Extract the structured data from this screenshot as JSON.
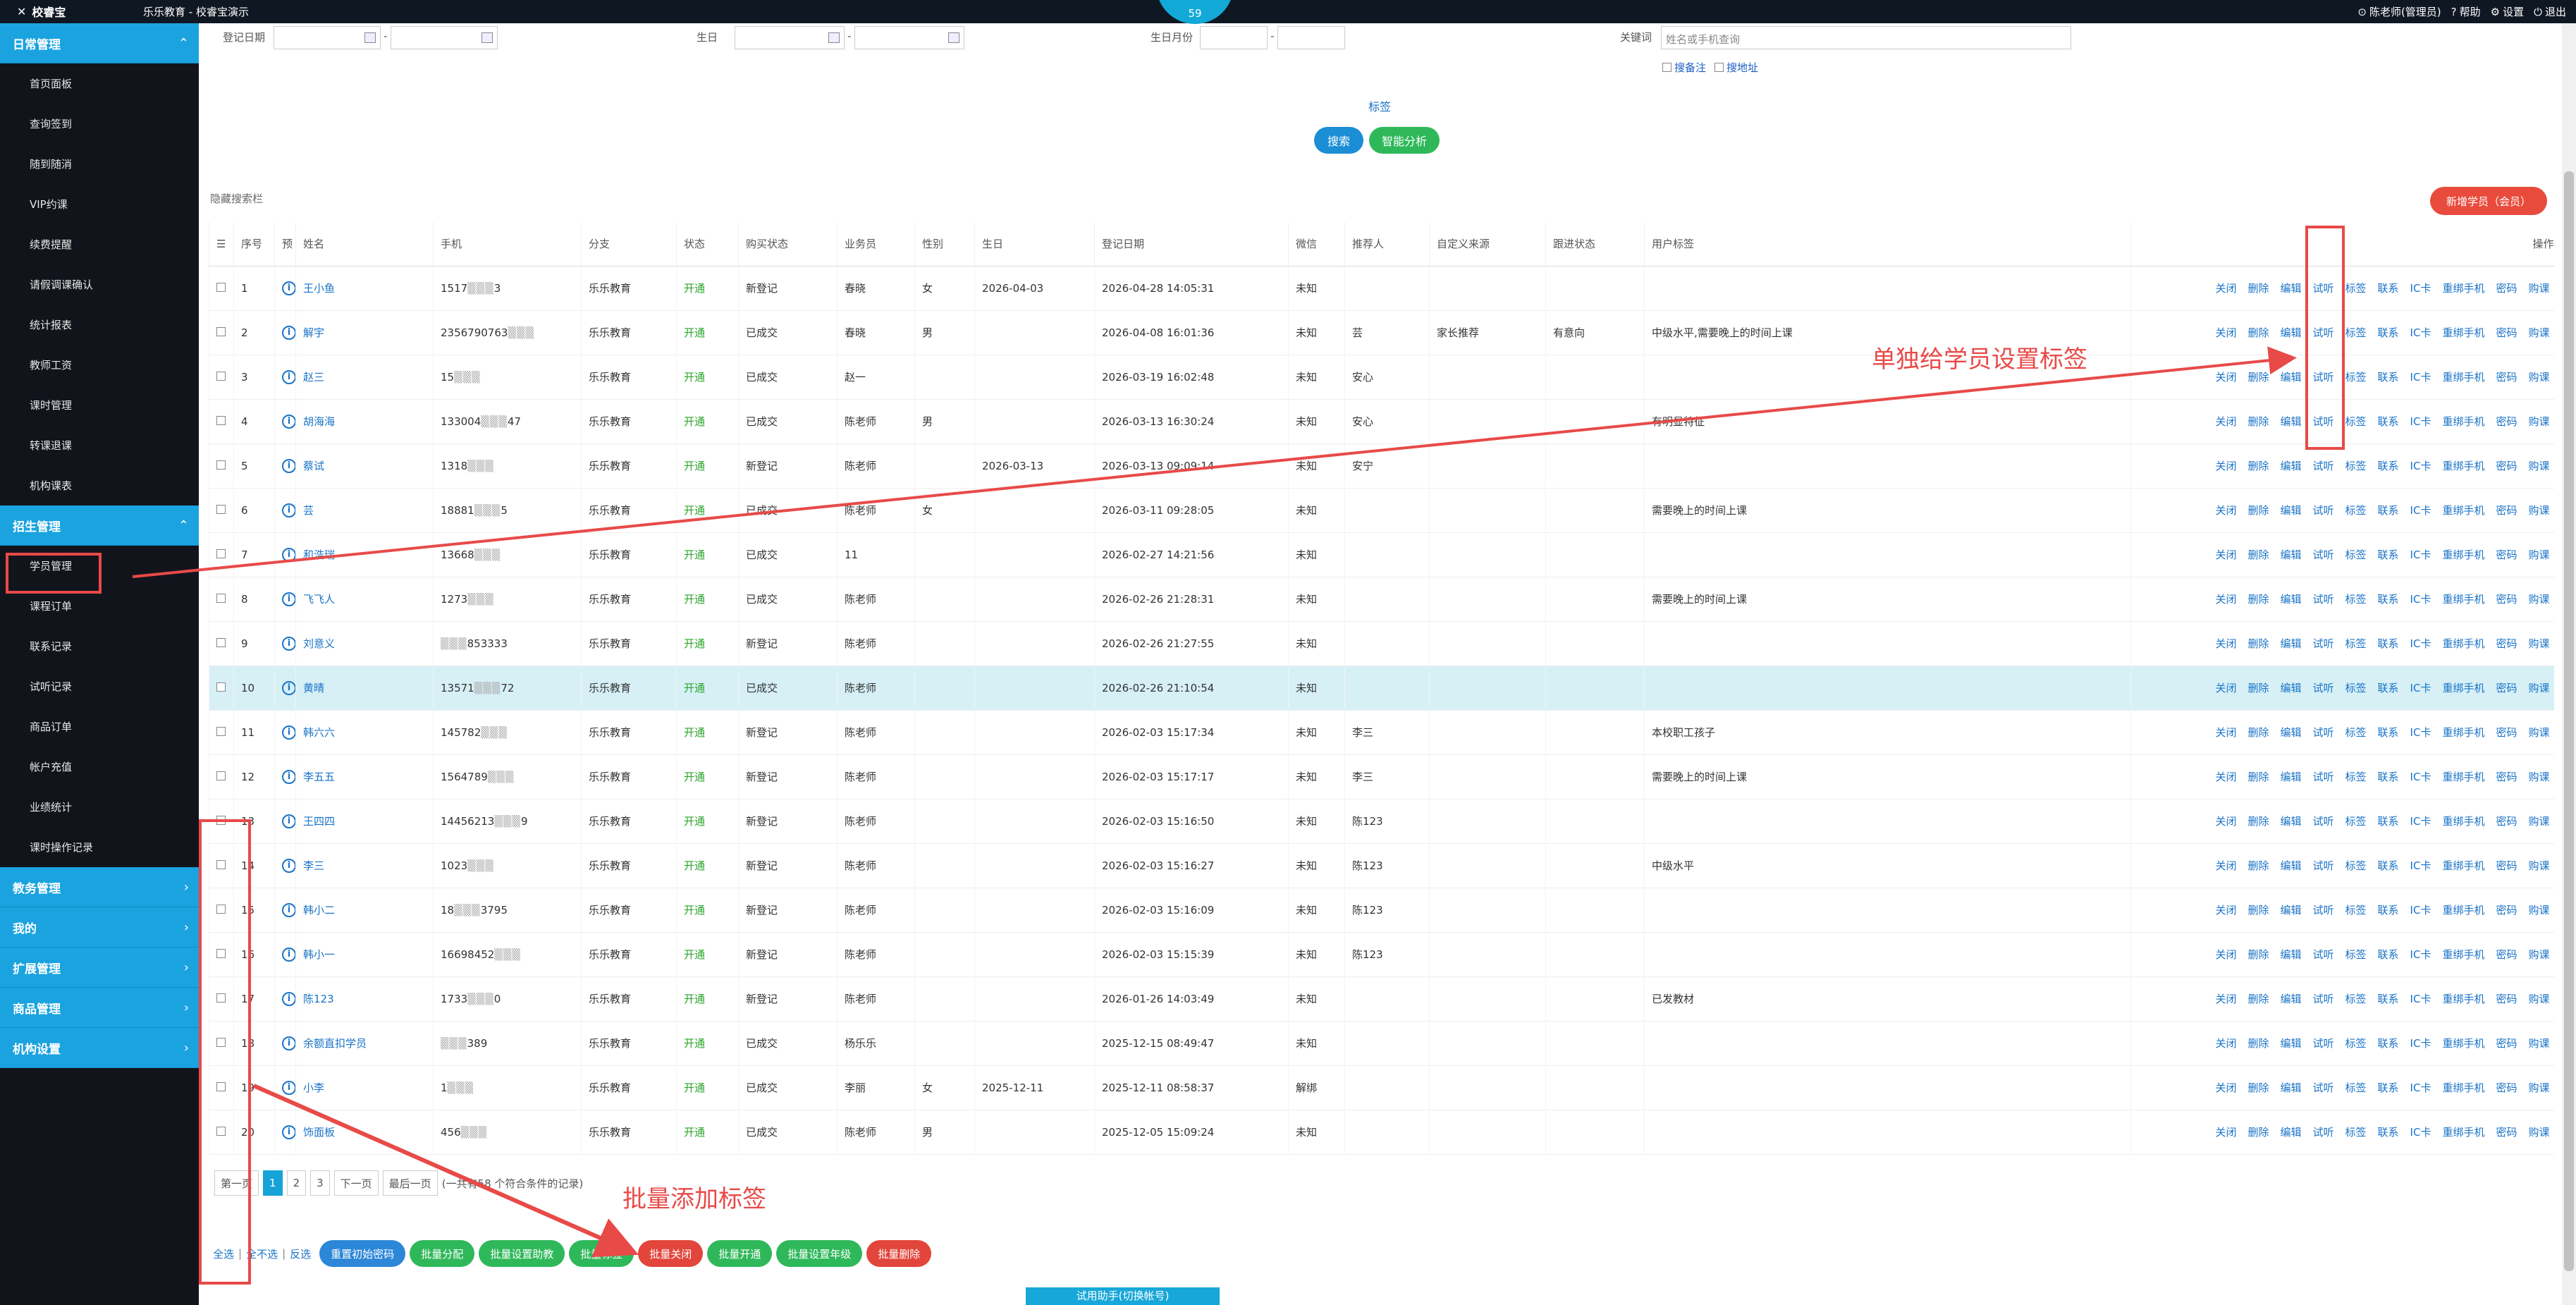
{
  "topbar": {
    "logo": "校睿宝",
    "subtitle": "乐乐教育 - 校睿宝演示",
    "bubble_count": "59",
    "user": "陈老师(管理员)",
    "help": "帮助",
    "settings": "设置",
    "logout": "退出"
  },
  "sidebar": {
    "groups": [
      {
        "label": "日常管理",
        "items": [
          "首页面板",
          "查询签到",
          "随到随消",
          "VIP约课",
          "续费提醒",
          "请假调课确认",
          "统计报表",
          "教师工资",
          "课时管理",
          "转课退课",
          "机构课表"
        ]
      },
      {
        "label": "招生管理",
        "items": [
          "学员管理",
          "课程订单",
          "联系记录",
          "试听记录",
          "商品订单",
          "帐户充值",
          "业绩统计",
          "课时操作记录"
        ]
      },
      {
        "label": "教务管理",
        "items": []
      },
      {
        "label": "我的",
        "items": []
      },
      {
        "label": "扩展管理",
        "items": []
      },
      {
        "label": "商品管理",
        "items": []
      },
      {
        "label": "机构设置",
        "items": []
      }
    ]
  },
  "filters": {
    "reg_date": "登记日期",
    "birthday": "生日",
    "birth_month": "生日月份",
    "keyword": "关键词",
    "keyword_placeholder": "姓名或手机查询",
    "search_remark": "搜备注",
    "search_address": "搜地址",
    "tag_link": "标签",
    "search_btn": "搜索",
    "analysis_btn": "智能分析",
    "hide_bar": "隐藏搜索栏",
    "add_student": "新增学员（会员）"
  },
  "table": {
    "headers": [
      "序号",
      "预",
      "姓名",
      "手机",
      "分支",
      "状态",
      "购买状态",
      "业务员",
      "性别",
      "生日",
      "登记日期",
      "微信",
      "推荐人",
      "自定义来源",
      "跟进状态",
      "用户标签",
      "操作"
    ],
    "ops": [
      "关闭",
      "删除",
      "编辑",
      "试听",
      "标签",
      "联系",
      "IC卡",
      "重绑手机",
      "密码",
      "购课"
    ],
    "rows": [
      {
        "no": "1",
        "name": "王小鱼",
        "phone": "1517",
        "phone_tail": "3",
        "branch": "乐乐教育",
        "status": "开通",
        "buy": "新登记",
        "sales": "春晓",
        "gender": "女",
        "birthday": "2026-04-03",
        "regdate": "2026-04-28 14:05:31",
        "wechat": "未知",
        "referrer": "",
        "source": "",
        "follow": "",
        "tag": ""
      },
      {
        "no": "2",
        "name": "解宇",
        "phone": "2356790763",
        "phone_tail": "",
        "branch": "乐乐教育",
        "status": "开通",
        "buy": "已成交",
        "sales": "春晓",
        "gender": "男",
        "birthday": "",
        "regdate": "2026-04-08 16:01:36",
        "wechat": "未知",
        "referrer": "芸",
        "source": "家长推荐",
        "follow": "有意向",
        "tag": "中级水平,需要晚上的时间上课"
      },
      {
        "no": "3",
        "name": "赵三",
        "phone": "15",
        "phone_tail": "",
        "branch": "乐乐教育",
        "status": "开通",
        "buy": "已成交",
        "sales": "赵一",
        "gender": "",
        "birthday": "",
        "regdate": "2026-03-19 16:02:48",
        "wechat": "未知",
        "referrer": "安心",
        "source": "",
        "follow": "",
        "tag": ""
      },
      {
        "no": "4",
        "name": "胡海海",
        "phone": "133004",
        "phone_tail": "47",
        "branch": "乐乐教育",
        "status": "开通",
        "buy": "已成交",
        "sales": "陈老师",
        "gender": "男",
        "birthday": "",
        "regdate": "2026-03-13 16:30:24",
        "wechat": "未知",
        "referrer": "安心",
        "source": "",
        "follow": "",
        "tag": "有明显特征"
      },
      {
        "no": "5",
        "name": "蔡试",
        "phone": "1318",
        "phone_tail": "",
        "branch": "乐乐教育",
        "status": "开通",
        "buy": "新登记",
        "sales": "陈老师",
        "gender": "",
        "birthday": "2026-03-13",
        "regdate": "2026-03-13 09:09:14",
        "wechat": "未知",
        "referrer": "安宁",
        "source": "",
        "follow": "",
        "tag": ""
      },
      {
        "no": "6",
        "name": "芸",
        "phone": "18881",
        "phone_tail": "5",
        "branch": "乐乐教育",
        "status": "开通",
        "buy": "已成交",
        "sales": "陈老师",
        "gender": "女",
        "birthday": "",
        "regdate": "2026-03-11 09:28:05",
        "wechat": "未知",
        "referrer": "",
        "source": "",
        "follow": "",
        "tag": "需要晚上的时间上课"
      },
      {
        "no": "7",
        "name": "和浩瑞",
        "phone": "13668",
        "phone_tail": "",
        "branch": "乐乐教育",
        "status": "开通",
        "buy": "已成交",
        "sales": "11",
        "gender": "",
        "birthday": "",
        "regdate": "2026-02-27 14:21:56",
        "wechat": "未知",
        "referrer": "",
        "source": "",
        "follow": "",
        "tag": ""
      },
      {
        "no": "8",
        "name": "飞飞人",
        "phone": "1273",
        "phone_tail": "",
        "branch": "乐乐教育",
        "status": "开通",
        "buy": "已成交",
        "sales": "陈老师",
        "gender": "",
        "birthday": "",
        "regdate": "2026-02-26 21:28:31",
        "wechat": "未知",
        "referrer": "",
        "source": "",
        "follow": "",
        "tag": "需要晚上的时间上课"
      },
      {
        "no": "9",
        "name": "刘意义",
        "phone": "",
        "phone_tail": "853",
        "phone_end": "333",
        "branch": "乐乐教育",
        "status": "开通",
        "buy": "新登记",
        "sales": "陈老师",
        "gender": "",
        "birthday": "",
        "regdate": "2026-02-26 21:27:55",
        "wechat": "未知",
        "referrer": "",
        "source": "",
        "follow": "",
        "tag": ""
      },
      {
        "no": "10",
        "name": "黄晴",
        "phone": "13571",
        "phone_tail": "72",
        "branch": "乐乐教育",
        "status": "开通",
        "buy": "已成交",
        "sales": "陈老师",
        "gender": "",
        "birthday": "",
        "regdate": "2026-02-26 21:10:54",
        "wechat": "未知",
        "referrer": "",
        "source": "",
        "follow": "",
        "tag": ""
      },
      {
        "no": "11",
        "name": "韩六六",
        "phone": "145782",
        "phone_tail": "",
        "branch": "乐乐教育",
        "status": "开通",
        "buy": "新登记",
        "sales": "陈老师",
        "gender": "",
        "birthday": "",
        "regdate": "2026-02-03 15:17:34",
        "wechat": "未知",
        "referrer": "李三",
        "source": "",
        "follow": "",
        "tag": "本校职工孩子"
      },
      {
        "no": "12",
        "name": "李五五",
        "phone": "1564789",
        "phone_tail": "",
        "branch": "乐乐教育",
        "status": "开通",
        "buy": "新登记",
        "sales": "陈老师",
        "gender": "",
        "birthday": "",
        "regdate": "2026-02-03 15:17:17",
        "wechat": "未知",
        "referrer": "李三",
        "source": "",
        "follow": "",
        "tag": "需要晚上的时间上课"
      },
      {
        "no": "13",
        "name": "王四四",
        "phone": "14456213",
        "phone_tail": "9",
        "branch": "乐乐教育",
        "status": "开通",
        "buy": "新登记",
        "sales": "陈老师",
        "gender": "",
        "birthday": "",
        "regdate": "2026-02-03 15:16:50",
        "wechat": "未知",
        "referrer": "陈123",
        "source": "",
        "follow": "",
        "tag": ""
      },
      {
        "no": "14",
        "name": "李三",
        "phone": "1023",
        "phone_tail": "",
        "branch": "乐乐教育",
        "status": "开通",
        "buy": "新登记",
        "sales": "陈老师",
        "gender": "",
        "birthday": "",
        "regdate": "2026-02-03 15:16:27",
        "wechat": "未知",
        "referrer": "陈123",
        "source": "",
        "follow": "",
        "tag": "中级水平"
      },
      {
        "no": "15",
        "name": "韩小二",
        "phone": "18",
        "phone_tail": "3795",
        "branch": "乐乐教育",
        "status": "开通",
        "buy": "新登记",
        "sales": "陈老师",
        "gender": "",
        "birthday": "",
        "regdate": "2026-02-03 15:16:09",
        "wechat": "未知",
        "referrer": "陈123",
        "source": "",
        "follow": "",
        "tag": ""
      },
      {
        "no": "16",
        "name": "韩小一",
        "phone": "16698452",
        "phone_tail": "",
        "branch": "乐乐教育",
        "status": "开通",
        "buy": "新登记",
        "sales": "陈老师",
        "gender": "",
        "birthday": "",
        "regdate": "2026-02-03 15:15:39",
        "wechat": "未知",
        "referrer": "陈123",
        "source": "",
        "follow": "",
        "tag": ""
      },
      {
        "no": "17",
        "name": "陈123",
        "phone": "1733",
        "phone_tail": "0",
        "branch": "乐乐教育",
        "status": "开通",
        "buy": "新登记",
        "sales": "陈老师",
        "gender": "",
        "birthday": "",
        "regdate": "2026-01-26 14:03:49",
        "wechat": "未知",
        "referrer": "",
        "source": "",
        "follow": "",
        "tag": "已发教材"
      },
      {
        "no": "18",
        "name": "余额直扣学员",
        "phone": "",
        "phone_tail": "389",
        "branch": "乐乐教育",
        "status": "开通",
        "buy": "已成交",
        "sales": "杨乐乐",
        "gender": "",
        "birthday": "",
        "regdate": "2025-12-15 08:49:47",
        "wechat": "未知",
        "referrer": "",
        "source": "",
        "follow": "",
        "tag": ""
      },
      {
        "no": "19",
        "name": "小李",
        "phone": "1",
        "phone_tail": "",
        "branch": "乐乐教育",
        "status": "开通",
        "buy": "已成交",
        "sales": "李丽",
        "gender": "女",
        "birthday": "2025-12-11",
        "regdate": "2025-12-11 08:58:37",
        "wechat": "解绑",
        "referrer": "",
        "source": "",
        "follow": "",
        "tag": ""
      },
      {
        "no": "20",
        "name": "饰面板",
        "phone": "456",
        "phone_tail": "",
        "branch": "乐乐教育",
        "status": "开通",
        "buy": "已成交",
        "sales": "陈老师",
        "gender": "男",
        "birthday": "",
        "regdate": "2025-12-05 15:09:24",
        "wechat": "未知",
        "referrer": "",
        "source": "",
        "follow": "",
        "tag": ""
      }
    ]
  },
  "pager": {
    "first": "第一页",
    "pages": [
      "1",
      "2",
      "3"
    ],
    "next": "下一页",
    "last": "最后一页",
    "summary": "(一共有58 个符合条件的记录)"
  },
  "bulk": {
    "select_all": "全选",
    "select_none": "全不选",
    "invert": "反选",
    "buttons": [
      {
        "label": "重置初始密码",
        "color": "blue"
      },
      {
        "label": "批量分配",
        "color": "green"
      },
      {
        "label": "批量设置助教",
        "color": "green"
      },
      {
        "label": "批量标签",
        "color": "green"
      },
      {
        "label": "批量关闭",
        "color": "red"
      },
      {
        "label": "批量开通",
        "color": "green"
      },
      {
        "label": "批量设置年级",
        "color": "green"
      },
      {
        "label": "批量删除",
        "color": "red"
      }
    ]
  },
  "trial_helper": "试用助手(切换帐号)",
  "annotations": {
    "single_tag": "单独给学员设置标签",
    "batch_tag": "批量添加标签"
  },
  "colors": {
    "accent": "#1ba3e0",
    "annotation": "#e84a48",
    "status_green": "#2aa52a"
  }
}
